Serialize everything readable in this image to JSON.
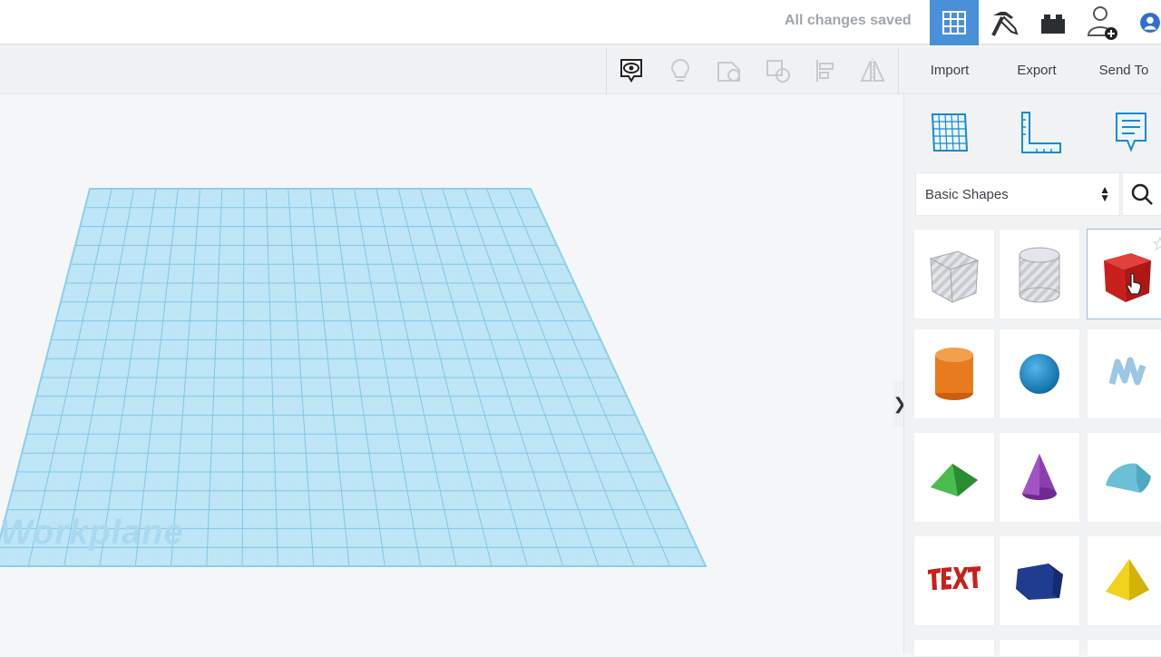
{
  "header": {
    "save_status": "All changes saved"
  },
  "toolbar": {
    "import_label": "Import",
    "export_label": "Export",
    "send_to_label": "Send To"
  },
  "canvas": {
    "workplane_label": "Workplane"
  },
  "panel": {
    "category_selected": "Basic Shapes",
    "shapes": [
      {
        "name": "box-hole"
      },
      {
        "name": "cylinder-hole"
      },
      {
        "name": "box"
      },
      {
        "name": "cylinder"
      },
      {
        "name": "sphere"
      },
      {
        "name": "scribble"
      },
      {
        "name": "roof"
      },
      {
        "name": "cone"
      },
      {
        "name": "round-roof"
      },
      {
        "name": "text"
      },
      {
        "name": "polygon"
      },
      {
        "name": "pyramid"
      }
    ]
  },
  "colors": {
    "accent": "#4a90d9",
    "workplane": "#8fd0ee",
    "box_red": "#d32a26",
    "cylinder_orange": "#e87b1e",
    "sphere_blue": "#1b86c7"
  }
}
